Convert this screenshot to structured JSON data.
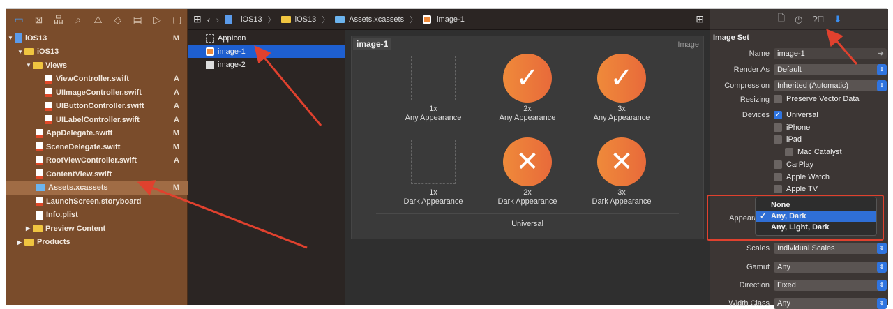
{
  "navigator": {
    "icons": [
      "folder-icon",
      "source-control-icon",
      "hierarchy-icon",
      "search-icon",
      "warning-icon",
      "test-icon",
      "debug-icon",
      "breakpoint-icon",
      "report-icon"
    ],
    "tree": [
      {
        "label": "iOS13",
        "badge": "M",
        "depth": 0,
        "kind": "proj",
        "tri": "▼"
      },
      {
        "label": "iOS13",
        "badge": "",
        "depth": 1,
        "kind": "folder",
        "tri": "▼"
      },
      {
        "label": "Views",
        "badge": "",
        "depth": 2,
        "kind": "folder",
        "tri": "▼"
      },
      {
        "label": "ViewController.swift",
        "badge": "A",
        "depth": 4,
        "kind": "swift",
        "tri": ""
      },
      {
        "label": "UIImageController.swift",
        "badge": "A",
        "depth": 4,
        "kind": "swift",
        "tri": ""
      },
      {
        "label": "UIButtonController.swift",
        "badge": "A",
        "depth": 4,
        "kind": "swift",
        "tri": ""
      },
      {
        "label": "UILabelController.swift",
        "badge": "A",
        "depth": 4,
        "kind": "swift",
        "tri": ""
      },
      {
        "label": "AppDelegate.swift",
        "badge": "M",
        "depth": 3,
        "kind": "swift",
        "tri": ""
      },
      {
        "label": "SceneDelegate.swift",
        "badge": "M",
        "depth": 3,
        "kind": "swift",
        "tri": ""
      },
      {
        "label": "RootViewController.swift",
        "badge": "A",
        "depth": 3,
        "kind": "swift",
        "tri": ""
      },
      {
        "label": "ContentView.swift",
        "badge": "",
        "depth": 3,
        "kind": "swift",
        "tri": ""
      },
      {
        "label": "Assets.xcassets",
        "badge": "M",
        "depth": 3,
        "kind": "assets",
        "tri": "",
        "selected": true
      },
      {
        "label": "LaunchScreen.storyboard",
        "badge": "",
        "depth": 3,
        "kind": "swift",
        "tri": ""
      },
      {
        "label": "Info.plist",
        "badge": "",
        "depth": 3,
        "kind": "plain",
        "tri": ""
      },
      {
        "label": "Preview Content",
        "badge": "",
        "depth": 2,
        "kind": "folder",
        "tri": "▶"
      },
      {
        "label": "Products",
        "badge": "",
        "depth": 1,
        "kind": "folder",
        "tri": "▶"
      }
    ]
  },
  "breadcrumb": [
    "iOS13",
    "iOS13",
    "Assets.xcassets",
    "image-1"
  ],
  "assets": [
    {
      "label": "AppIcon"
    },
    {
      "label": "image-1",
      "selected": true
    },
    {
      "label": "image-2"
    }
  ],
  "editor": {
    "title": "image-1",
    "type_label": "Image",
    "footer": "Universal",
    "slots": [
      {
        "scale": "1x",
        "appearance": "Any Appearance",
        "glyph": ""
      },
      {
        "scale": "2x",
        "appearance": "Any Appearance",
        "glyph": "✓"
      },
      {
        "scale": "3x",
        "appearance": "Any Appearance",
        "glyph": "✓"
      },
      {
        "scale": "1x",
        "appearance": "Dark Appearance",
        "glyph": ""
      },
      {
        "scale": "2x",
        "appearance": "Dark Appearance",
        "glyph": "✕"
      },
      {
        "scale": "3x",
        "appearance": "Dark Appearance",
        "glyph": "✕"
      }
    ]
  },
  "inspector": {
    "section": "Image Set",
    "name_label": "Name",
    "name_value": "image-1",
    "render_label": "Render As",
    "render_value": "Default",
    "compression_label": "Compression",
    "compression_value": "Inherited (Automatic)",
    "resizing_label": "Resizing",
    "resizing_value": "Preserve Vector Data",
    "devices_label": "Devices",
    "devices": [
      {
        "label": "Universal",
        "checked": true
      },
      {
        "label": "iPhone"
      },
      {
        "label": "iPad"
      },
      {
        "label": "Mac Catalyst"
      },
      {
        "label": "CarPlay"
      },
      {
        "label": "Apple Watch"
      },
      {
        "label": "Apple TV"
      }
    ],
    "appearance_label": "Appearances",
    "appearance_options": [
      "None",
      "Any, Dark",
      "Any, Light, Dark"
    ],
    "appearance_selected": "Any, Dark",
    "scales_label": "Scales",
    "scales_value": "Individual Scales",
    "gamut_label": "Gamut",
    "gamut_value": "Any",
    "direction_label": "Direction",
    "direction_value": "Fixed",
    "width_label": "Width Class",
    "width_value": "Any"
  },
  "colors": {
    "accent": "#2f74e0",
    "navigator": "#7a4c2b",
    "annotation": "#e0412e",
    "asset": "#ef8a3a"
  }
}
